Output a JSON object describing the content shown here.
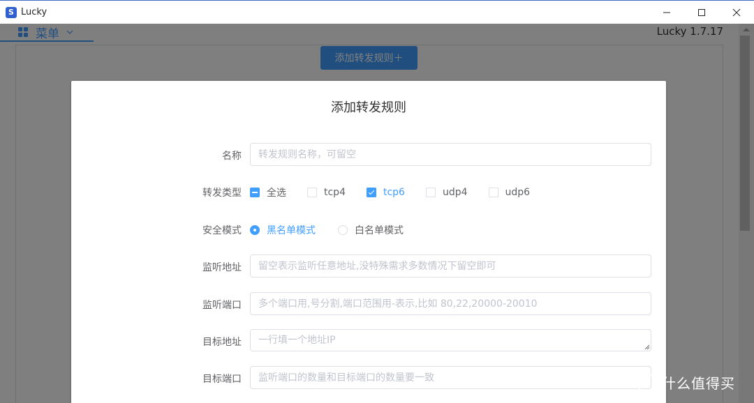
{
  "window": {
    "title": "Lucky"
  },
  "app": {
    "menu_label": "菜单",
    "version": "Lucky 1.7.17",
    "add_rule_button": "添加转发规则＋"
  },
  "dialog": {
    "title": "添加转发规则",
    "fields": {
      "name": {
        "label": "名称",
        "placeholder": "转发规则名称，可留空",
        "value": ""
      },
      "forward_type": {
        "label": "转发类型",
        "options": [
          {
            "label": "全选",
            "state": "indeterminate"
          },
          {
            "label": "tcp4",
            "state": "unchecked"
          },
          {
            "label": "tcp6",
            "state": "checked"
          },
          {
            "label": "udp4",
            "state": "unchecked"
          },
          {
            "label": "udp6",
            "state": "unchecked"
          }
        ]
      },
      "security_mode": {
        "label": "安全模式",
        "options": [
          {
            "label": "黑名单模式",
            "selected": true
          },
          {
            "label": "白名单模式",
            "selected": false
          }
        ]
      },
      "listen_address": {
        "label": "监听地址",
        "placeholder": "留空表示监听任意地址,没特殊需求多数情况下留空即可",
        "value": ""
      },
      "listen_port": {
        "label": "监听端口",
        "placeholder": "多个端口用,号分割,端口范围用-表示,比如 80,22,20000-20010",
        "value": ""
      },
      "target_address": {
        "label": "目标地址",
        "placeholder": "一行填一个地址IP",
        "value": ""
      },
      "target_port": {
        "label": "目标端口",
        "placeholder": "监听端口的数量和目标端口的数量要一致",
        "value": ""
      }
    }
  },
  "watermark": {
    "text": "什么值得买"
  },
  "colors": {
    "accent": "#409eff",
    "overlay": "rgba(0,0,0,0.5)",
    "label": "#606266",
    "placeholder": "#c0c4cc"
  }
}
